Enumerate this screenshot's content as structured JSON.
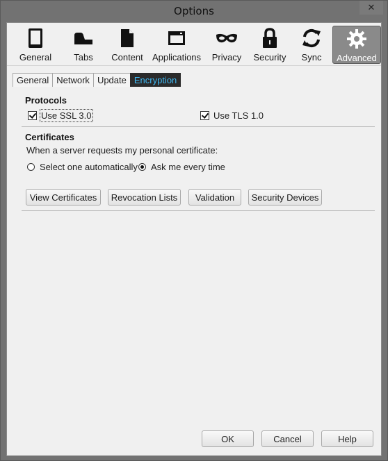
{
  "window": {
    "title": "Options",
    "close_glyph": "✕"
  },
  "panes": [
    {
      "label": "General",
      "icon": "phone-icon"
    },
    {
      "label": "Tabs",
      "icon": "tab-icon"
    },
    {
      "label": "Content",
      "icon": "document-icon"
    },
    {
      "label": "Applications",
      "icon": "window-icon"
    },
    {
      "label": "Privacy",
      "icon": "mask-icon"
    },
    {
      "label": "Security",
      "icon": "lock-icon"
    },
    {
      "label": "Sync",
      "icon": "sync-icon"
    },
    {
      "label": "Advanced",
      "icon": "gear-icon",
      "selected": true
    }
  ],
  "tabs": [
    {
      "label": "General"
    },
    {
      "label": "Network"
    },
    {
      "label": "Update"
    },
    {
      "label": "Encryption",
      "active": true
    }
  ],
  "protocols": {
    "title": "Protocols",
    "ssl": {
      "label": "Use SSL 3.0",
      "checked": true
    },
    "tls": {
      "label": "Use TLS 1.0",
      "checked": true
    }
  },
  "certificates": {
    "title": "Certificates",
    "prompt": "When a server requests my personal certificate:",
    "options": [
      {
        "label": "Select one automatically",
        "selected": false
      },
      {
        "label": "Ask me every time",
        "selected": true
      }
    ],
    "buttons": {
      "view": "View Certificates",
      "revocation": "Revocation Lists",
      "validation": "Validation",
      "devices": "Security Devices"
    }
  },
  "footer": {
    "ok": "OK",
    "cancel": "Cancel",
    "help": "Help"
  },
  "colors": {
    "active_tab_text": "#3fb8f2",
    "selected_pane_bg": "#8a8a8a"
  }
}
